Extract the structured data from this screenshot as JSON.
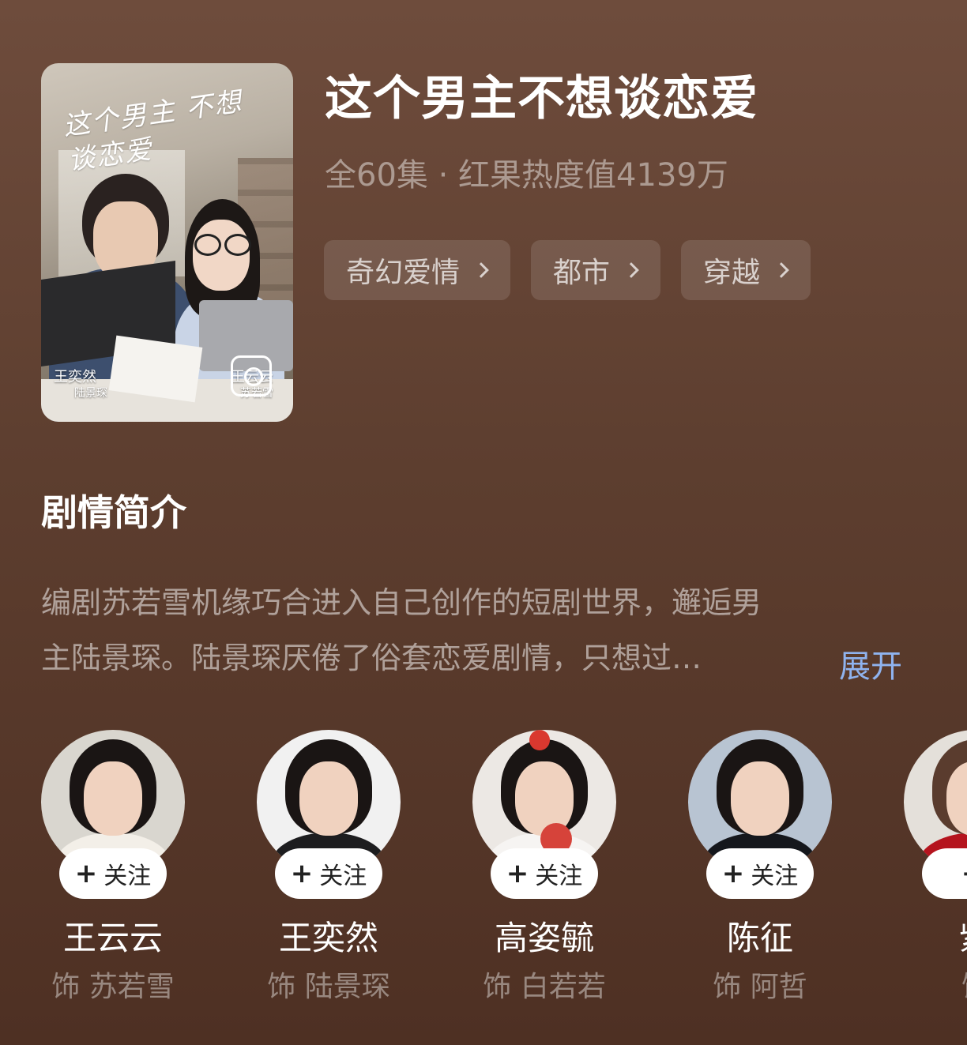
{
  "drama": {
    "poster_title_art": "这个男主 不想谈恋爱",
    "poster_credit_left_actor": "王奕然",
    "poster_credit_left_role": "陆景琛",
    "poster_credit_right_actor": "王云云",
    "poster_credit_right_role": "苏若雪",
    "title": "这个男主不想谈恋爱",
    "meta": "全60集 · 红果热度值4139万",
    "tags": [
      {
        "label": "奇幻爱情",
        "icon": "chevron-right-icon"
      },
      {
        "label": "都市",
        "icon": "chevron-right-icon"
      },
      {
        "label": "穿越",
        "icon": "chevron-right-icon"
      }
    ]
  },
  "synopsis": {
    "heading": "剧情简介",
    "line1": "编剧苏若雪机缘巧合进入自己创作的短剧世界，邂逅男",
    "line2": "主陆景琛。陆景琛厌倦了俗套恋爱剧情，只想过…",
    "expand_label": "展开"
  },
  "cast": [
    {
      "name": "王云云",
      "role": "饰 苏若雪",
      "follow_label": "关注"
    },
    {
      "name": "王奕然",
      "role": "饰 陆景琛",
      "follow_label": "关注"
    },
    {
      "name": "高姿毓",
      "role": "饰 白若若",
      "follow_label": "关注"
    },
    {
      "name": "陈征",
      "role": "饰 阿哲",
      "follow_label": "关注"
    },
    {
      "name": "紫",
      "role": "饰",
      "follow_label": ""
    }
  ],
  "colors": {
    "background_top": "#6e4c3c",
    "background_bottom": "#4e3023",
    "expand_link": "#8fb3ef",
    "follow_button_bg": "#ffffff"
  }
}
